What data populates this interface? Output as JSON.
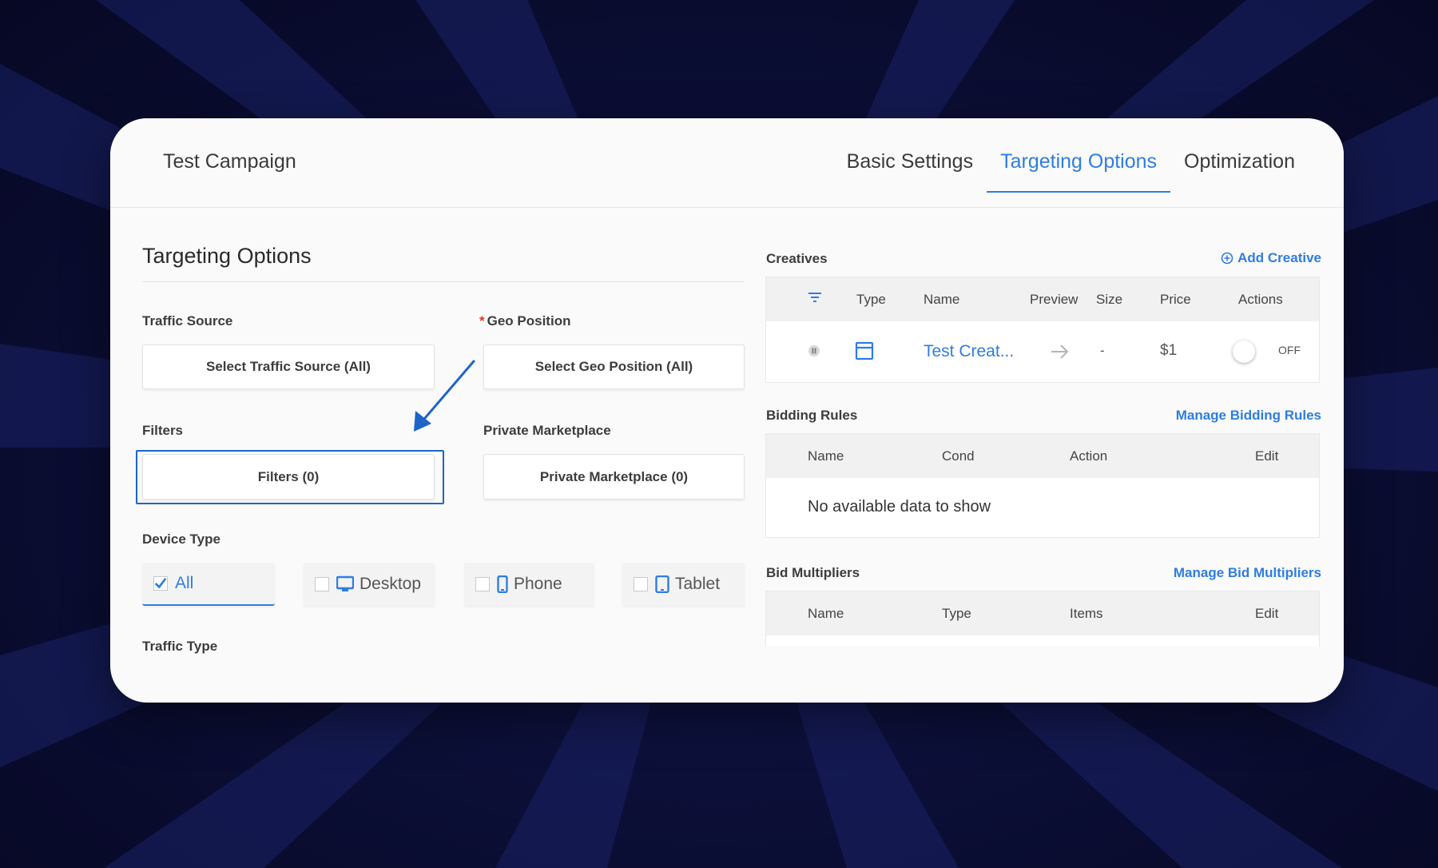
{
  "header": {
    "campaign_title": "Test Campaign",
    "tabs": [
      {
        "label": "Basic Settings",
        "active": false
      },
      {
        "label": "Targeting Options",
        "active": true
      },
      {
        "label": "Optimization",
        "active": false
      }
    ]
  },
  "targeting": {
    "title": "Targeting Options",
    "traffic_source": {
      "label": "Traffic Source",
      "button": "Select Traffic Source (All)"
    },
    "geo_position": {
      "required_mark": "*",
      "label": "Geo Position",
      "button": "Select Geo Position (All)"
    },
    "filters": {
      "label": "Filters",
      "button": "Filters (0)"
    },
    "private_marketplace": {
      "label": "Private Marketplace",
      "button": "Private Marketplace (0)"
    },
    "device_type": {
      "label": "Device Type",
      "options": [
        {
          "label": "All",
          "checked": true,
          "icon": "check-icon"
        },
        {
          "label": "Desktop",
          "checked": false,
          "icon": "desktop-icon"
        },
        {
          "label": "Phone",
          "checked": false,
          "icon": "phone-icon"
        },
        {
          "label": "Tablet",
          "checked": false,
          "icon": "tablet-icon"
        }
      ]
    },
    "traffic_type": {
      "label": "Traffic Type"
    }
  },
  "creatives": {
    "label": "Creatives",
    "add_link": "Add Creative",
    "columns": [
      "Type",
      "Name",
      "Preview",
      "Size",
      "Price",
      "Actions"
    ],
    "rows": [
      {
        "name": "Test Creat...",
        "size": "-",
        "price": "$1",
        "toggle": "OFF"
      }
    ]
  },
  "bidding_rules": {
    "label": "Bidding Rules",
    "manage_link": "Manage Bidding Rules",
    "columns": [
      "Name",
      "Cond",
      "Action",
      "Edit"
    ],
    "empty_message": "No available data to show"
  },
  "bid_multipliers": {
    "label": "Bid Multipliers",
    "manage_link": "Manage Bid Multipliers",
    "columns": [
      "Name",
      "Type",
      "Items",
      "Edit"
    ]
  },
  "colors": {
    "accent": "#2f7de0",
    "highlight": "#1d65c7",
    "required": "#e0392b",
    "background": "#0c0e2e",
    "card": "#fafafa"
  }
}
